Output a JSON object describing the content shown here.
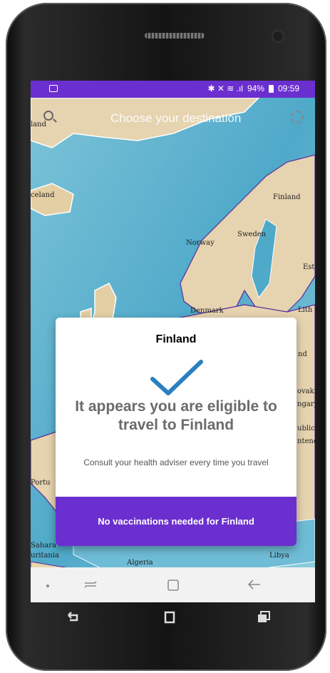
{
  "status_bar": {
    "icons": "✱ ✕ ≋ .ıl",
    "battery_percent": "94%",
    "time": "09:59"
  },
  "search": {
    "placeholder": "Choose your destination"
  },
  "map": {
    "labels": [
      "land",
      "celand",
      "Finland",
      "Sweden",
      "Norway",
      "Esto",
      "Denmark",
      "Lith",
      "nd",
      "ovaki",
      "ngary",
      "ublic",
      "nteneg",
      "Portu",
      "Sahara",
      "uritania",
      "Algeria",
      "Libya"
    ]
  },
  "dialog": {
    "title": "Finland",
    "headline": "It appears you are eligible to travel to Finland",
    "subtext": "Consult your health adviser every time you travel",
    "button_label": "No vaccinations needed for Finland"
  },
  "icons": {
    "search": "search-icon",
    "settings": "gear-icon",
    "check": "checkmark-icon",
    "recent_apps": "recent-apps-icon",
    "home": "home-icon",
    "back": "back-arrow-icon"
  },
  "colors": {
    "accent": "#6b2fcf",
    "check": "#2a7fc0",
    "headline": "#6b6b6b",
    "map_sea": "#6fbcd6",
    "map_land": "#e6d3b0"
  }
}
